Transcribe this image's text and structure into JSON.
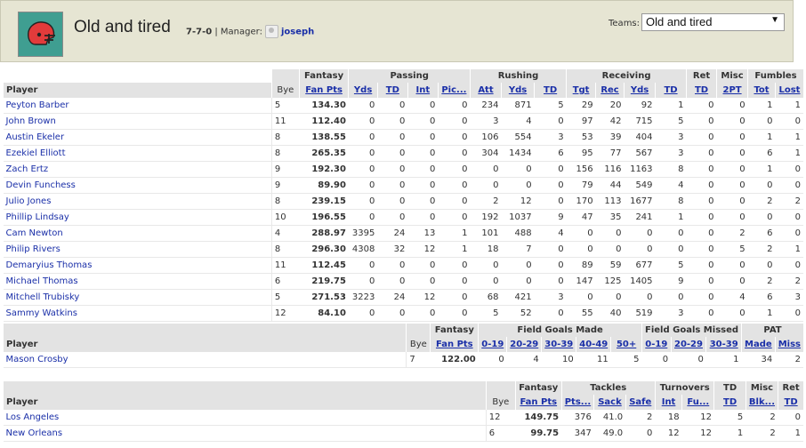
{
  "header": {
    "team_name": "Old and tired",
    "record": "7-7-0",
    "manager_label": "| Manager:",
    "manager_name": "joseph",
    "teams_label": "Teams:",
    "teams_selected": "Old and tired",
    "logo_icon": "football-helmet-icon",
    "colors": {
      "logo_bg": "#3f9e91",
      "helmet": "#e23b3b",
      "link": "#1a2fa8"
    }
  },
  "offense": {
    "groups": [
      "Fantasy",
      "Passing",
      "Rushing",
      "Receiving",
      "Ret",
      "Misc",
      "Fumbles"
    ],
    "player_label": "Player",
    "cols": [
      "Bye",
      "Fan Pts",
      "Yds",
      "TD",
      "Int",
      "Pic...",
      "Att",
      "Yds",
      "TD",
      "Tgt",
      "Rec",
      "Yds",
      "TD",
      "TD",
      "2PT",
      "Tot",
      "Lost"
    ],
    "rows": [
      {
        "name": "Peyton Barber",
        "vals": [
          "5",
          "134.30",
          "0",
          "0",
          "0",
          "0",
          "234",
          "871",
          "5",
          "29",
          "20",
          "92",
          "1",
          "0",
          "0",
          "1",
          "1"
        ]
      },
      {
        "name": "John Brown",
        "vals": [
          "11",
          "112.40",
          "0",
          "0",
          "0",
          "0",
          "3",
          "4",
          "0",
          "97",
          "42",
          "715",
          "5",
          "0",
          "0",
          "0",
          "0"
        ]
      },
      {
        "name": "Austin Ekeler",
        "vals": [
          "8",
          "138.55",
          "0",
          "0",
          "0",
          "0",
          "106",
          "554",
          "3",
          "53",
          "39",
          "404",
          "3",
          "0",
          "0",
          "1",
          "1"
        ]
      },
      {
        "name": "Ezekiel Elliott",
        "vals": [
          "8",
          "265.35",
          "0",
          "0",
          "0",
          "0",
          "304",
          "1434",
          "6",
          "95",
          "77",
          "567",
          "3",
          "0",
          "0",
          "6",
          "1"
        ]
      },
      {
        "name": "Zach Ertz",
        "vals": [
          "9",
          "192.30",
          "0",
          "0",
          "0",
          "0",
          "0",
          "0",
          "0",
          "156",
          "116",
          "1163",
          "8",
          "0",
          "0",
          "1",
          "0"
        ]
      },
      {
        "name": "Devin Funchess",
        "vals": [
          "9",
          "89.90",
          "0",
          "0",
          "0",
          "0",
          "0",
          "0",
          "0",
          "79",
          "44",
          "549",
          "4",
          "0",
          "0",
          "0",
          "0"
        ]
      },
      {
        "name": "Julio Jones",
        "vals": [
          "8",
          "239.15",
          "0",
          "0",
          "0",
          "0",
          "2",
          "12",
          "0",
          "170",
          "113",
          "1677",
          "8",
          "0",
          "0",
          "2",
          "2"
        ]
      },
      {
        "name": "Phillip Lindsay",
        "vals": [
          "10",
          "196.55",
          "0",
          "0",
          "0",
          "0",
          "192",
          "1037",
          "9",
          "47",
          "35",
          "241",
          "1",
          "0",
          "0",
          "0",
          "0"
        ]
      },
      {
        "name": "Cam Newton",
        "vals": [
          "4",
          "288.97",
          "3395",
          "24",
          "13",
          "1",
          "101",
          "488",
          "4",
          "0",
          "0",
          "0",
          "0",
          "0",
          "2",
          "6",
          "0"
        ]
      },
      {
        "name": "Philip Rivers",
        "vals": [
          "8",
          "296.30",
          "4308",
          "32",
          "12",
          "1",
          "18",
          "7",
          "0",
          "0",
          "0",
          "0",
          "0",
          "0",
          "5",
          "2",
          "1"
        ]
      },
      {
        "name": "Demaryius Thomas",
        "vals": [
          "11",
          "112.45",
          "0",
          "0",
          "0",
          "0",
          "0",
          "0",
          "0",
          "89",
          "59",
          "677",
          "5",
          "0",
          "0",
          "0",
          "0"
        ]
      },
      {
        "name": "Michael Thomas",
        "vals": [
          "6",
          "219.75",
          "0",
          "0",
          "0",
          "0",
          "0",
          "0",
          "0",
          "147",
          "125",
          "1405",
          "9",
          "0",
          "0",
          "2",
          "2"
        ]
      },
      {
        "name": "Mitchell Trubisky",
        "vals": [
          "5",
          "271.53",
          "3223",
          "24",
          "12",
          "0",
          "68",
          "421",
          "3",
          "0",
          "0",
          "0",
          "0",
          "0",
          "4",
          "6",
          "3"
        ]
      },
      {
        "name": "Sammy Watkins",
        "vals": [
          "12",
          "84.10",
          "0",
          "0",
          "0",
          "0",
          "5",
          "52",
          "0",
          "55",
          "40",
          "519",
          "3",
          "0",
          "0",
          "1",
          "0"
        ]
      }
    ]
  },
  "kicker": {
    "groups": [
      "Fantasy",
      "Field Goals Made",
      "Field Goals Missed",
      "PAT"
    ],
    "player_label": "Player",
    "cols": [
      "Bye",
      "Fan Pts",
      "0-19",
      "20-29",
      "30-39",
      "40-49",
      "50+",
      "0-19",
      "20-29",
      "30-39",
      "Made",
      "Miss"
    ],
    "rows": [
      {
        "name": "Mason Crosby",
        "vals": [
          "7",
          "122.00",
          "0",
          "4",
          "10",
          "11",
          "5",
          "0",
          "0",
          "1",
          "34",
          "2"
        ]
      }
    ]
  },
  "defense": {
    "groups": [
      "Fantasy",
      "Tackles",
      "Turnovers",
      "TD",
      "Misc",
      "Ret"
    ],
    "player_label": "Player",
    "cols": [
      "Bye",
      "Fan Pts",
      "Pts...",
      "Sack",
      "Safe",
      "Int",
      "Fu...",
      "TD",
      "Blk...",
      "TD"
    ],
    "rows": [
      {
        "name": "Los Angeles",
        "vals": [
          "12",
          "149.75",
          "376",
          "41.0",
          "2",
          "18",
          "12",
          "5",
          "2",
          "0"
        ]
      },
      {
        "name": "New Orleans",
        "vals": [
          "6",
          "99.75",
          "347",
          "49.0",
          "0",
          "12",
          "12",
          "1",
          "2",
          "1"
        ]
      }
    ]
  }
}
